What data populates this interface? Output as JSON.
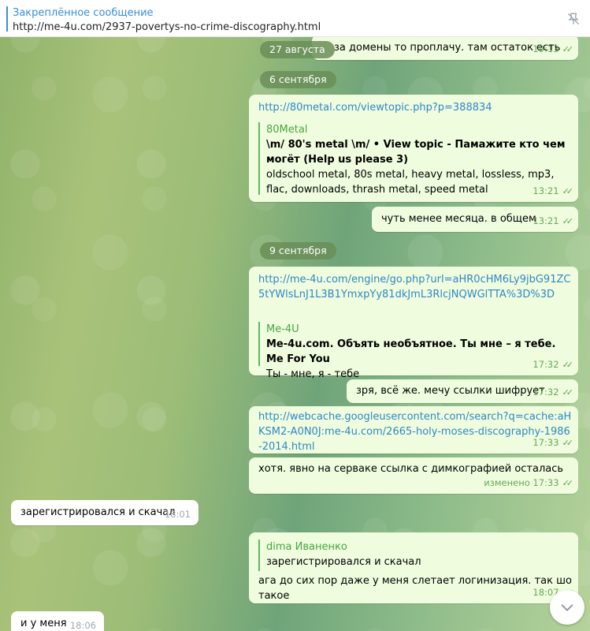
{
  "pinned": {
    "title": "Закреплённое сообщение",
    "text": "http://me-4u.com/2937-povertys-no-crime-discography.html",
    "unpin_icon": "unpin-icon"
  },
  "dates": {
    "d1": "27 августа",
    "d2": "6 сентября",
    "d3": "9 сентября"
  },
  "messages": {
    "m1": {
      "text": "за домены то проплачу. там остаток есть",
      "time": "19:13"
    },
    "m2": {
      "link": "http://80metal.com/viewtopic.php?p=388834",
      "site": "80Metal",
      "title": "\\m/ 80's metal \\m/ • View topic - Памажите кто чем могёт (Help us please 3)",
      "desc": "oldschool metal, 80s metal, heavy metal, lossless, mp3, flac, downloads, thrash metal, speed metal",
      "time": "13:21"
    },
    "m3": {
      "text": "чуть менее месяца. в общем",
      "time": "13:21"
    },
    "m4": {
      "link": "http://me-4u.com/engine/go.php?url=aHR0cHM6Ly9jbG91ZC5tYWlsLnJ1L3B1YmxpYy81dkJmL3RlcjNQWGlTTA%3D%3D",
      "site": "Me-4U",
      "title": "Me-4u.com. Объять необъятное. Ты мне – я тебе. Me For You",
      "desc": "Ты - мне, я - тебе",
      "time": "17:32"
    },
    "m5": {
      "text": "зря, всё же. мечу ссылки шифрует",
      "time": "17:32"
    },
    "m6": {
      "link": "http://webcache.googleusercontent.com/search?q=cache:aHKSM2-A0N0J:me-4u.com/2665-holy-moses-discography-1986-2014.html",
      "time": "17:33"
    },
    "m7": {
      "text": "хотя. явно на серваке ссылка с димкографией осталась",
      "time": "изменено 17:33"
    },
    "m8": {
      "text": "зарегистрировался и скачал",
      "time": "18:01"
    },
    "m9": {
      "reply_name": "dima Иваненко",
      "reply_text": "зарегистрировался и скачал",
      "text": "ага до сих пор даже у меня слетает логинизация. так шо такое",
      "time": "18:07"
    },
    "m10": {
      "text": "и у меня",
      "time": "18:06"
    }
  },
  "colors": {
    "out_bubble": "#effdde",
    "in_bubble": "#ffffff",
    "link": "#2f86c6",
    "accent_green": "#4aa342"
  }
}
